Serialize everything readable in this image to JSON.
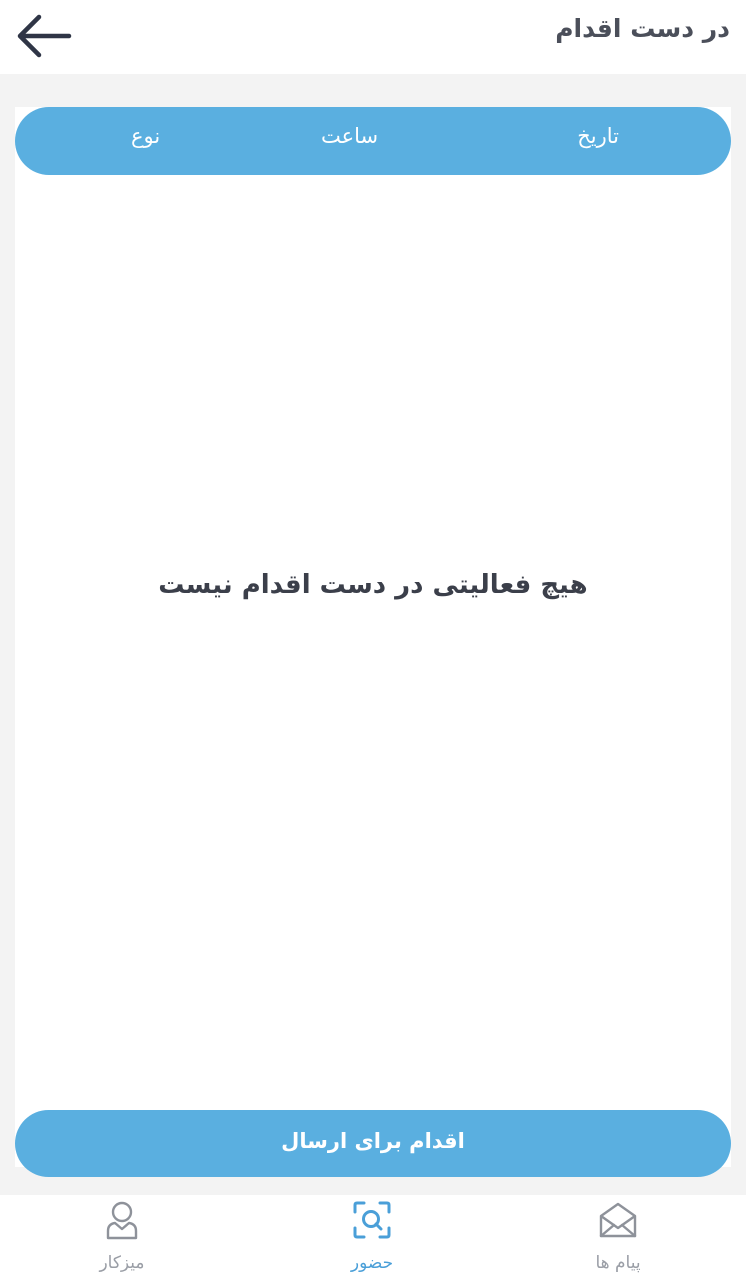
{
  "header": {
    "title": "در دست اقدام",
    "back_icon": "arrow-left-icon"
  },
  "table": {
    "columns": [
      "تاریخ",
      "ساعت",
      "نوع"
    ]
  },
  "empty_state": {
    "message": "هیچ فعالیتی در دست اقدام نیست"
  },
  "action_button": {
    "label": "اقدام برای ارسال"
  },
  "bottom_nav": {
    "items": [
      {
        "label": "میزکار",
        "icon": "user-icon",
        "active": false
      },
      {
        "label": "حضور",
        "icon": "scan-icon",
        "active": true
      },
      {
        "label": "پیام ها",
        "icon": "envelope-open-icon",
        "active": false
      }
    ]
  },
  "colors": {
    "accent": "#5aafe0",
    "active_nav": "#4a9fd8",
    "inactive_nav": "#9a9ea6",
    "title_text": "#4b4f5a",
    "background": "#f3f3f3"
  }
}
